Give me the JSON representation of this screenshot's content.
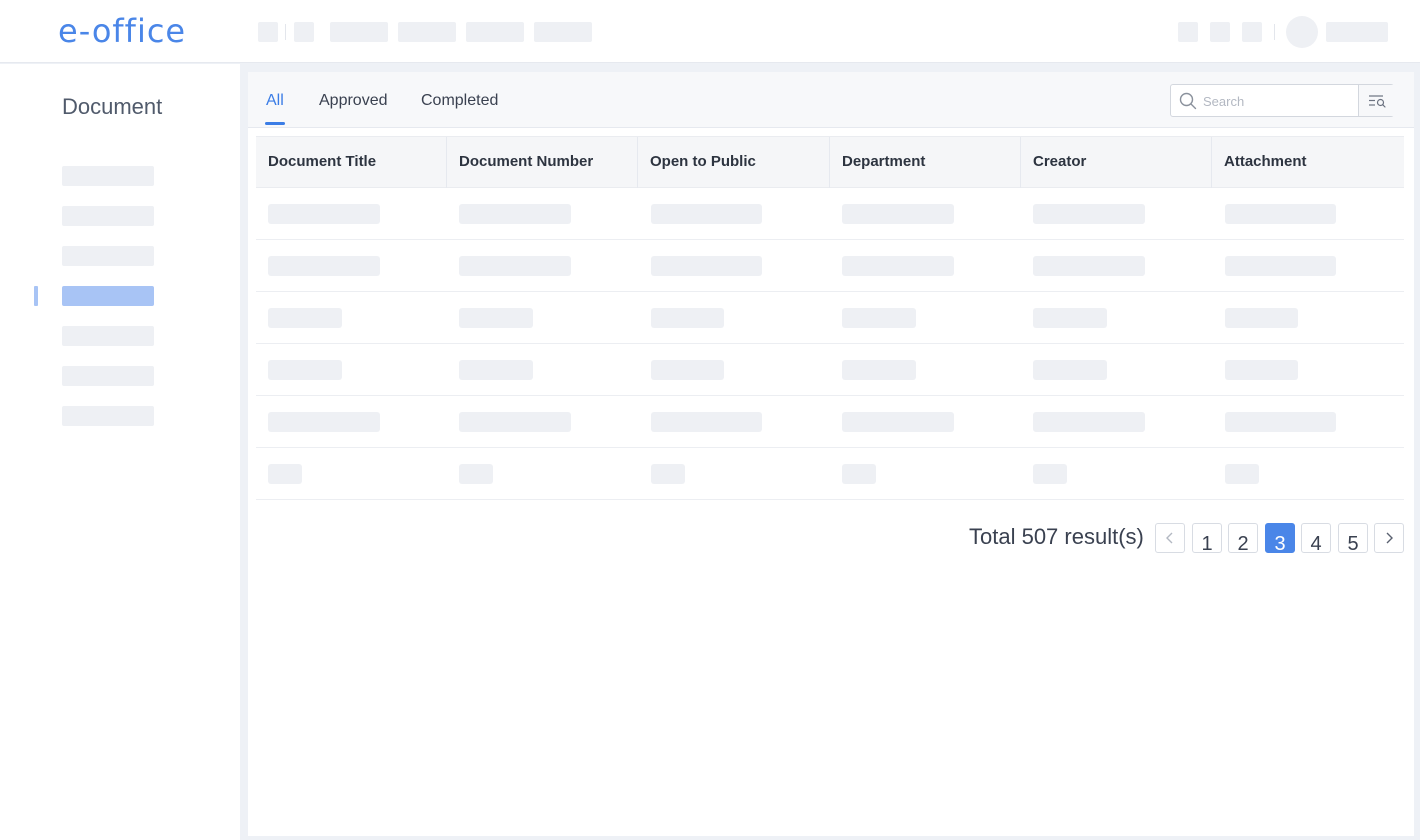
{
  "header": {
    "logo": "e-office"
  },
  "sidebar": {
    "title": "Document",
    "active_index": 3,
    "item_count": 7
  },
  "tabs": [
    {
      "label": "All",
      "active": true
    },
    {
      "label": "Approved",
      "active": false
    },
    {
      "label": "Completed",
      "active": false
    }
  ],
  "search": {
    "placeholder": "Search"
  },
  "table": {
    "columns": [
      "Document Title",
      "Document Number",
      "Open to Public",
      "Department",
      "Creator",
      "Attachment"
    ]
  },
  "pagination": {
    "total_text": "Total 507 result(s)",
    "pages": [
      "1",
      "2",
      "3",
      "4",
      "5"
    ],
    "current": "3",
    "prev_icon": "chevron-left-icon",
    "next_icon": "chevron-right-icon"
  },
  "colors": {
    "accent": "#4a86e8",
    "tab_active": "#3b7de6",
    "skeleton": "#eef0f4",
    "sidebar_active": "#a8c4f5"
  }
}
